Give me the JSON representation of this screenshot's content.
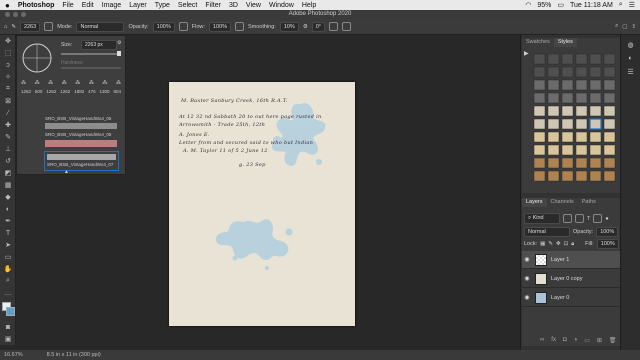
{
  "menubar": {
    "app": "Photoshop",
    "items": [
      "File",
      "Edit",
      "Image",
      "Layer",
      "Type",
      "Select",
      "Filter",
      "3D",
      "View",
      "Window",
      "Help"
    ],
    "battery": "95%",
    "clock": "Tue 11:18 AM"
  },
  "window": {
    "title": "Adobe Photoshop 2020"
  },
  "options": {
    "brush_size": "2263",
    "mode_label": "Mode:",
    "mode_value": "Normal",
    "opacity_label": "Opacity:",
    "opacity_value": "100%",
    "flow_label": "Flow:",
    "flow_value": "100%",
    "smoothing_label": "Smoothing:",
    "smoothing_value": "10%",
    "angle_value": "0°"
  },
  "brush_popup": {
    "size_label": "Size:",
    "size_value": "2263 px",
    "hardness_label": "Hardness:",
    "preset_sizes": [
      "1262",
      "500",
      "1262",
      "1262",
      "1882",
      "476",
      "1300",
      "804"
    ],
    "brush_names": [
      "SRO_BSB_VintageHandWo4_05",
      "SRO_BSB_VintageHandWo4_05",
      "SRO_BSB_VintageHandWo4_07"
    ]
  },
  "document": {
    "handwriting_lines": [
      "M. Baxter Sanbury Creek, 16th R.A.T.",
      "At 12 32 nd Sabbath 20 to out here page rusted in",
      "Arrowsmith - Trade 25th, 12th",
      "A. Jones  E.",
      "Letter from and secured said to who but Indian",
      "A. M. Taylor 11 of 5 2 June 12",
      "g. 23 Sep"
    ]
  },
  "styles_panel": {
    "tabs": [
      "Swatches",
      "Styles"
    ],
    "active_tab": "Styles"
  },
  "layers_panel": {
    "tabs": [
      "Layers",
      "Channels",
      "Paths"
    ],
    "kind_label": "Kind",
    "blend_mode": "Normal",
    "opacity_label": "Opacity:",
    "opacity_value": "100%",
    "lock_label": "Lock:",
    "fill_label": "Fill:",
    "fill_value": "100%",
    "layers": [
      {
        "name": "Layer 1",
        "color": "#d8d8d8"
      },
      {
        "name": "Layer 0 copy",
        "color": "#e4dfd0"
      },
      {
        "name": "Layer 0",
        "color": "#a9c4db"
      }
    ]
  },
  "status": {
    "zoom": "16.67%",
    "doc_info": "8.5 in x 11 in (300 ppi)"
  },
  "colors": {
    "accent_blue": "#1a73c7",
    "stain_blue": "#a9cbe0"
  }
}
